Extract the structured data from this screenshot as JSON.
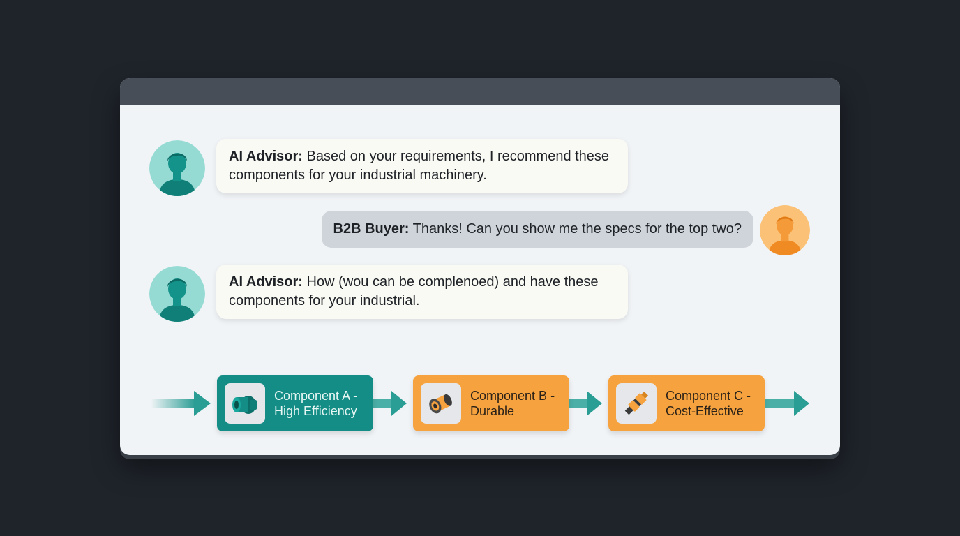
{
  "chat": {
    "messages": [
      {
        "role": "advisor",
        "speaker": "AI Advisor:",
        "text": "Based on your requirements, I recommend these components for your industrial machinery."
      },
      {
        "role": "buyer",
        "speaker": "B2B Buyer:",
        "text": "Thanks! Can you show me the specs for the top two?"
      },
      {
        "role": "advisor",
        "speaker": "AI Advisor:",
        "text": "How (wou can be complenoed) and have these components for your industrial."
      }
    ]
  },
  "components": [
    {
      "line1": "Component A -",
      "line2": "High Efficiency",
      "icon": "teal-fitting-icon",
      "color": "#138d85"
    },
    {
      "line1": "Component B -",
      "line2": "Durable",
      "icon": "orange-bearing-icon",
      "color": "#f6a23e"
    },
    {
      "line1": "Component C -",
      "line2": "Cost-Effective",
      "icon": "orange-connector-icon",
      "color": "#f6a23e"
    }
  ],
  "colors": {
    "background": "#1f242b",
    "window": "#f1f4f7",
    "titlebar": "#474e57",
    "teal": "#138d85",
    "orange": "#f6a23e",
    "advisor_avatar_bg": "#95dbd4",
    "buyer_avatar_bg": "#fbc176"
  }
}
